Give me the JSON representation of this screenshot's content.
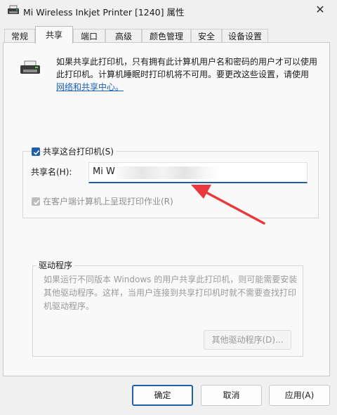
{
  "window": {
    "title": "Mi Wireless Inkjet Printer [1240] 属性",
    "close_glyph": "✕"
  },
  "tabs": [
    {
      "label": "常规",
      "active": false
    },
    {
      "label": "共享",
      "active": true
    },
    {
      "label": "端口",
      "active": false
    },
    {
      "label": "高级",
      "active": false
    },
    {
      "label": "颜色管理",
      "active": false
    },
    {
      "label": "安全",
      "active": false
    },
    {
      "label": "设备设置",
      "active": false
    }
  ],
  "sharing": {
    "info_text": "如果共享此打印机，只有拥有此计算机用户名和密码的用户才可以使用此打印机。计算机睡眠时打印机将不可用。要更改这些设置，请使用",
    "info_link": "网络和共享中心。",
    "share_checkbox_label": "共享这台打印机(S)",
    "share_checked": true,
    "share_name_label": "共享名(H):",
    "share_name_value": "Mi W",
    "render_checkbox_label": "在客户端计算机上呈现打印作业(R)",
    "render_checked": true
  },
  "drivers": {
    "title": "驱动程序",
    "text": "如果运行不同版本 Windows 的用户共享此打印机，则可能需要安装其他驱动程序。这样，当用户连接到共享打印机时就不需要查找打印机驱动程序。",
    "other_drivers_button": "其他驱动程序(D)..."
  },
  "footer": {
    "ok": "确定",
    "cancel": "取消",
    "apply": "应用(A)"
  },
  "colors": {
    "accent": "#1f5ea8",
    "annotation_arrow": "#e8393d"
  },
  "icons": {
    "title": "printer-icon",
    "info": "printer-icon",
    "close": "close-icon",
    "check": "checkmark-icon"
  }
}
